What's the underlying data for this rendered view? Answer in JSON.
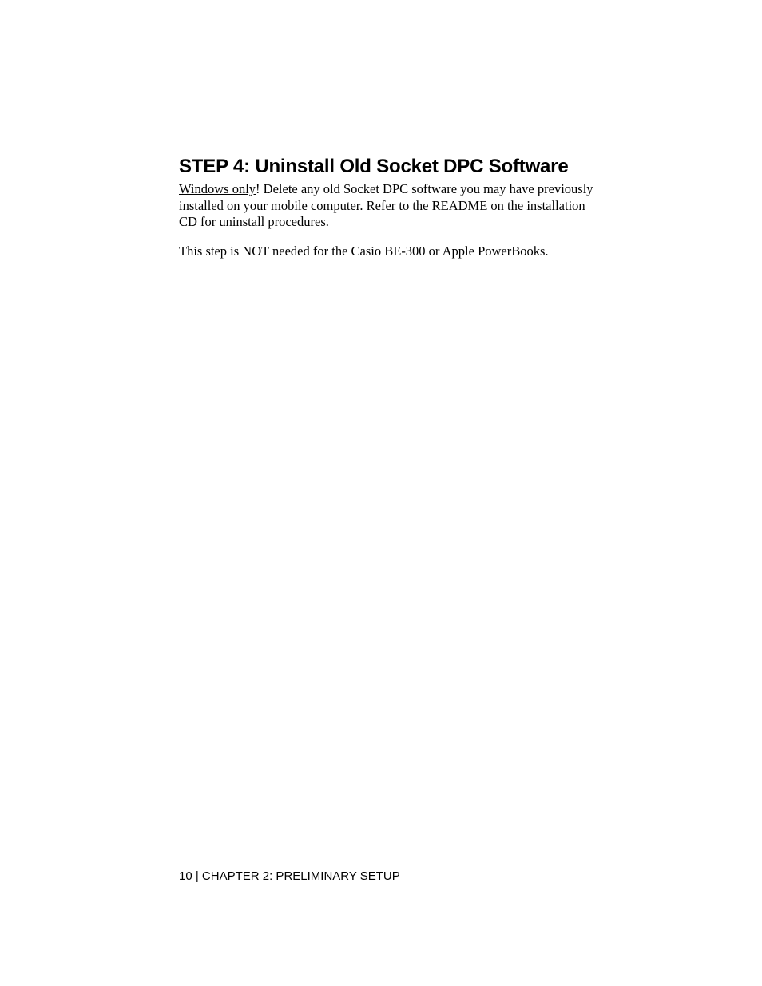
{
  "heading": "STEP 4: Uninstall Old Socket DPC Software",
  "para1_lead": "Windows only",
  "para1_rest": "! Delete any old Socket DPC software you may have previously installed on your mobile computer. Refer to the README on the installation CD for uninstall procedures.",
  "para2": "This step is NOT needed for the Casio BE-300 or Apple PowerBooks.",
  "footer": "10 | CHAPTER 2: PRELIMINARY SETUP"
}
